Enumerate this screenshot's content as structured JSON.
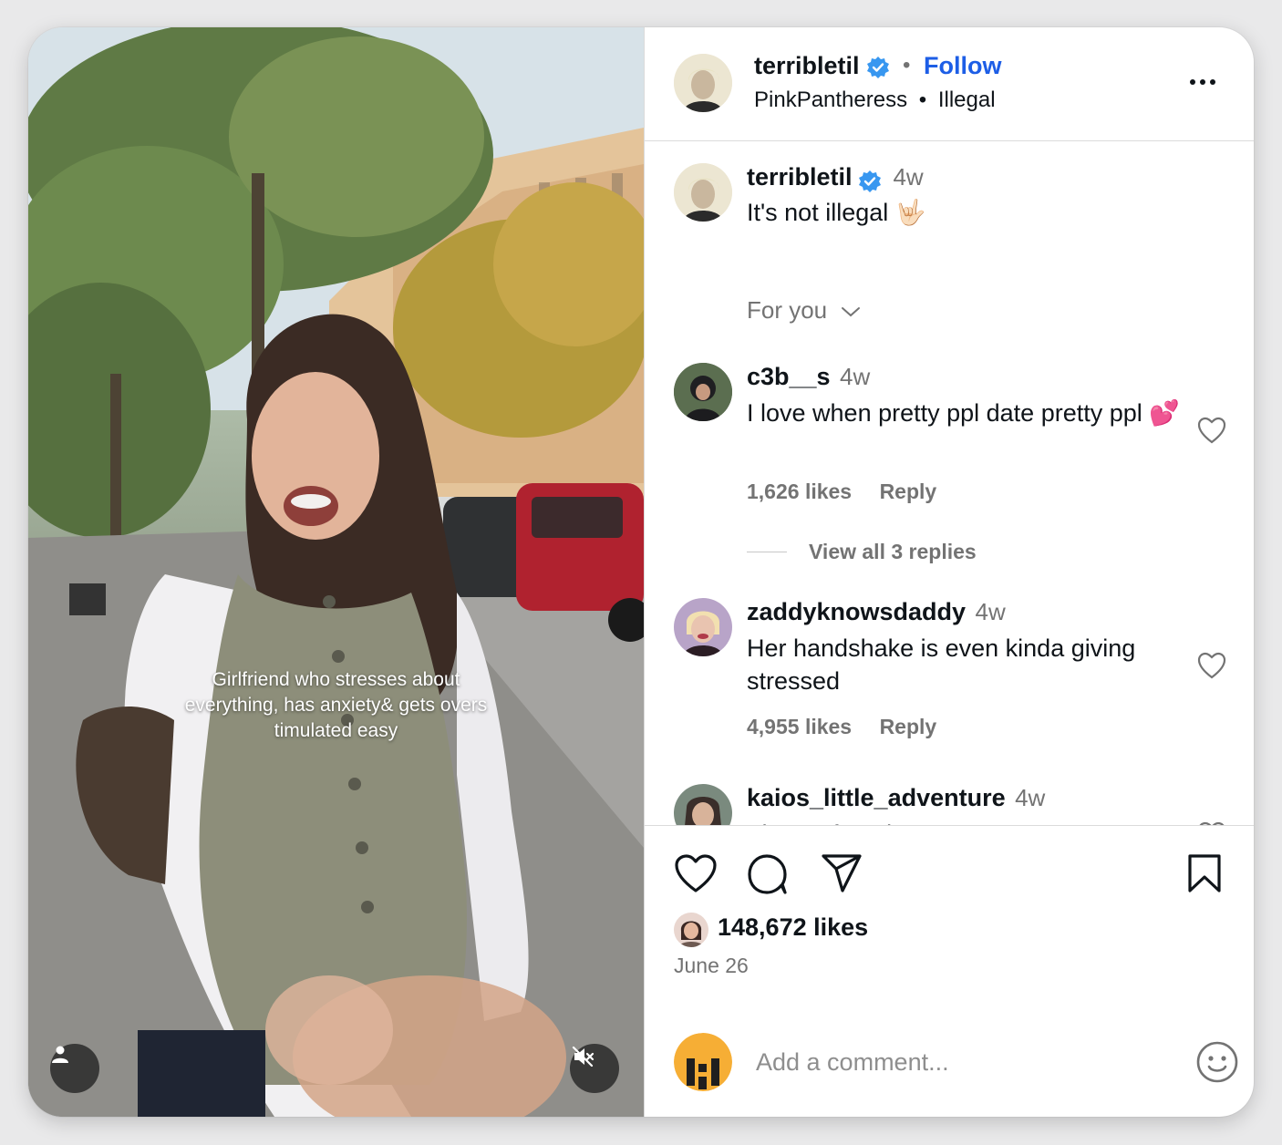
{
  "post": {
    "author": "terribletil",
    "follow_label": "Follow",
    "separator": "•",
    "audio_artist": "PinkPantheress",
    "audio_dot": "•",
    "audio_track": "Illegal",
    "overlay_caption": "Girlfriend who stresses about everything, has anxiety& gets overs timulated easy",
    "caption": {
      "username": "terribletil",
      "time": "4w",
      "text": "It's not illegal 🤟🏻"
    },
    "filter_label": "For you",
    "likes": "148,672 likes",
    "date": "June 26",
    "add_comment_placeholder": "Add a comment..."
  },
  "comments": [
    {
      "username": "c3b__s",
      "time": "4w",
      "text": "I love when pretty ppl date pretty ppl 💕",
      "likes": "1,626 likes",
      "reply_label": "Reply",
      "replies_label": "View all 3 replies"
    },
    {
      "username": "zaddyknowsdaddy",
      "time": "4w",
      "text": "Her handshake is even kinda giving stressed",
      "likes": "4,955 likes",
      "reply_label": "Reply"
    },
    {
      "username": "kaios_little_adventure",
      "time": "4w",
      "text": "The perfect duo"
    }
  ],
  "colors": {
    "accent": "#1d5ee6",
    "verified": "#3897f0",
    "muted": "#737373"
  },
  "icons": [
    "user-tag-icon",
    "mute-icon",
    "verified-icon",
    "more-options-icon",
    "chevron-down-icon",
    "heart-icon",
    "comment-icon",
    "share-icon",
    "bookmark-icon",
    "emoji-icon"
  ]
}
